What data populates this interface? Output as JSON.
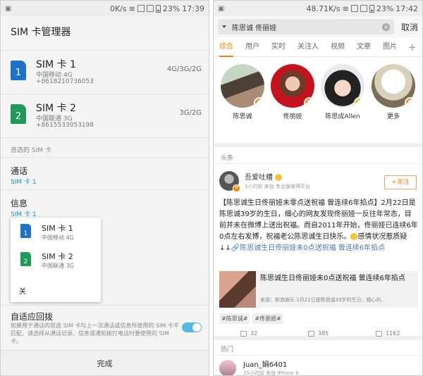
{
  "left": {
    "status": {
      "speed": "0K/s",
      "battery": "23%",
      "time": "17:39"
    },
    "title": "SIM 卡管理器",
    "sims": [
      {
        "name": "SIM 卡 1",
        "badge": "1",
        "carrier": "中国移动 4G",
        "number": "+8618210736053",
        "network": "4G/3G/2G",
        "color": "#1e72c8"
      },
      {
        "name": "SIM 卡 2",
        "badge": "2",
        "carrier": "中国联通 3G",
        "number": "+8615533053198",
        "network": "3G/2G",
        "color": "#20995a"
      }
    ],
    "preferred_header": "首选的 SIM 卡",
    "prefs": [
      {
        "title": "通话",
        "value": "SIM 卡 1"
      },
      {
        "title": "信息",
        "value": "SIM 卡 1"
      }
    ],
    "popup": {
      "items": [
        {
          "name": "SIM 卡 1",
          "badge": "1",
          "carrier": "中国移动 4G"
        },
        {
          "name": "SIM 卡 2",
          "badge": "2",
          "carrier": "中国联通 3G"
        }
      ],
      "close": "关"
    },
    "adaptive": {
      "title": "自适应回拨",
      "desc": "如果用于通话的首选 SIM 卡与上一次通话或信息所使用的 SIM 卡不匹配，请选择从通话记录、信息或通知拨打电话时要使用的 SIM 卡。",
      "enabled": true
    },
    "done": "完成"
  },
  "right": {
    "status": {
      "speed": "48.71K/s",
      "battery": "23%",
      "time": "17:42"
    },
    "search_query": "陈思诚 佟丽娅",
    "cancel": "取消",
    "tabs": [
      "综合",
      "用户",
      "实时",
      "关注人",
      "视频",
      "文章",
      "图片"
    ],
    "active_tab": 0,
    "people": [
      {
        "name": "陈思诚",
        "badge": "V",
        "badge_color": "#f08300"
      },
      {
        "name": "佟丽娅",
        "badge": "V",
        "badge_color": "#f08300"
      },
      {
        "name": "陈思成Allen",
        "badge": "V",
        "badge_color": "#f0b400"
      },
      {
        "name": "更多",
        "badge": "V",
        "badge_color": "#f08300"
      }
    ],
    "section_headline": "头条",
    "post": {
      "user": "吾爱吐槽",
      "badge": "V",
      "meta": "3小时前  来自 专业版微博平台",
      "follow": "+关注",
      "text_plain": "【陈思诚生日佟丽娅未零点送祝福 曾连续6年掐点】2月22日是陈思诚39岁的生日，细心的网友发现佟丽娅一反往年常态，目前并未在微博上送出祝福。而自2011年开始，佟丽娅已连续6年0点左右发博，祝福老公陈思诚生日快乐。",
      "text_tail": "感情状况惹质疑↓↓",
      "text_link": "陈思诚生日佟丽娅未0点送祝福 曾连续6年掐点",
      "card_title": "陈思诚生日佟丽娅未0点送祝福 曾连续6年掐点",
      "card_source": "来源：新浪娱乐 2月22日是陈思诚39岁的生日，细心的...",
      "tags": [
        "#陈思诚#",
        "#佟丽娅#"
      ],
      "reposts": "32",
      "comments": "385",
      "likes": "1162"
    },
    "section_hot": "热门",
    "post2": {
      "user": "Juan_娟6401",
      "meta": "15小时前  来自 iPhone 6"
    }
  }
}
